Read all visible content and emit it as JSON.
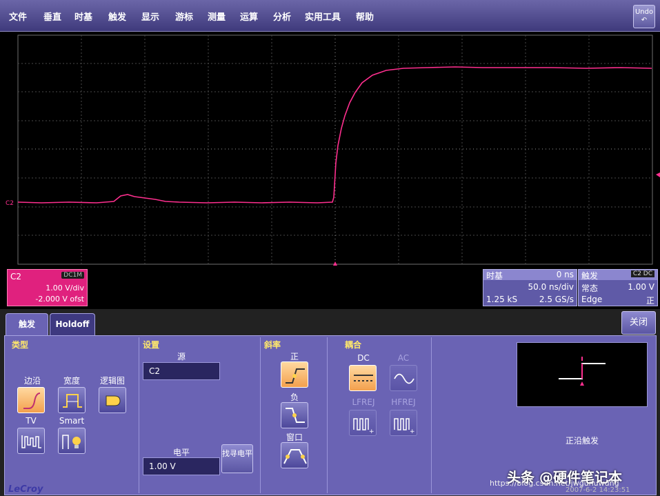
{
  "menu": [
    "文件",
    "垂直",
    "时基",
    "触发",
    "显示",
    "游标",
    "测量",
    "运算",
    "分析",
    "实用工具",
    "帮助"
  ],
  "undo": {
    "label": "Undo",
    "icon": "undo-arrow-icon"
  },
  "channel_marker": "C2",
  "channel_box": {
    "label": "C2",
    "coupling": "DC1M",
    "vdiv": "1.00 V/div",
    "offset": "-2.000 V ofst",
    "color": "#e0217e"
  },
  "timebase_box": {
    "title": "时基",
    "delay": "0 ns",
    "tdiv": "50.0 ns/div",
    "samples": "1.25 kS",
    "rate": "2.5 GS/s"
  },
  "trigger_box": {
    "title": "触发",
    "channel_tag": "C2 DC",
    "mode": "常态",
    "level": "1.00 V",
    "type": "Edge",
    "slope": "正"
  },
  "tabs": {
    "trigger": "触发",
    "holdoff": "Holdoff"
  },
  "close_label": "关闭",
  "type_section": {
    "title": "类型",
    "edge": "边沿",
    "width": "宽度",
    "logic": "逻辑图",
    "tv": "TV",
    "smart": "Smart"
  },
  "settings_section": {
    "title": "设置",
    "source_label": "源",
    "source_value": "C2",
    "level_label": "电平",
    "level_value": "1.00 V",
    "find_level": "找寻电平"
  },
  "slope_section": {
    "title": "斜率",
    "positive": "正",
    "negative": "负",
    "window": "窗口"
  },
  "coupling_section": {
    "title": "耦合",
    "dc": "DC",
    "ac": "AC",
    "lfrej": "LFREJ",
    "hfrej": "HFREJ"
  },
  "preview_label": "正沿触发",
  "brand": "LeCroy",
  "datetime": "2007-6-2 14:23:51",
  "watermark": "头条 @硬件笔记本",
  "csdn": "https://blog.csdn.net/jwgunuwdng",
  "colors": {
    "trace": "#ff2f8f",
    "panel": "#6a63b4",
    "accent": "#ffe86b"
  }
}
